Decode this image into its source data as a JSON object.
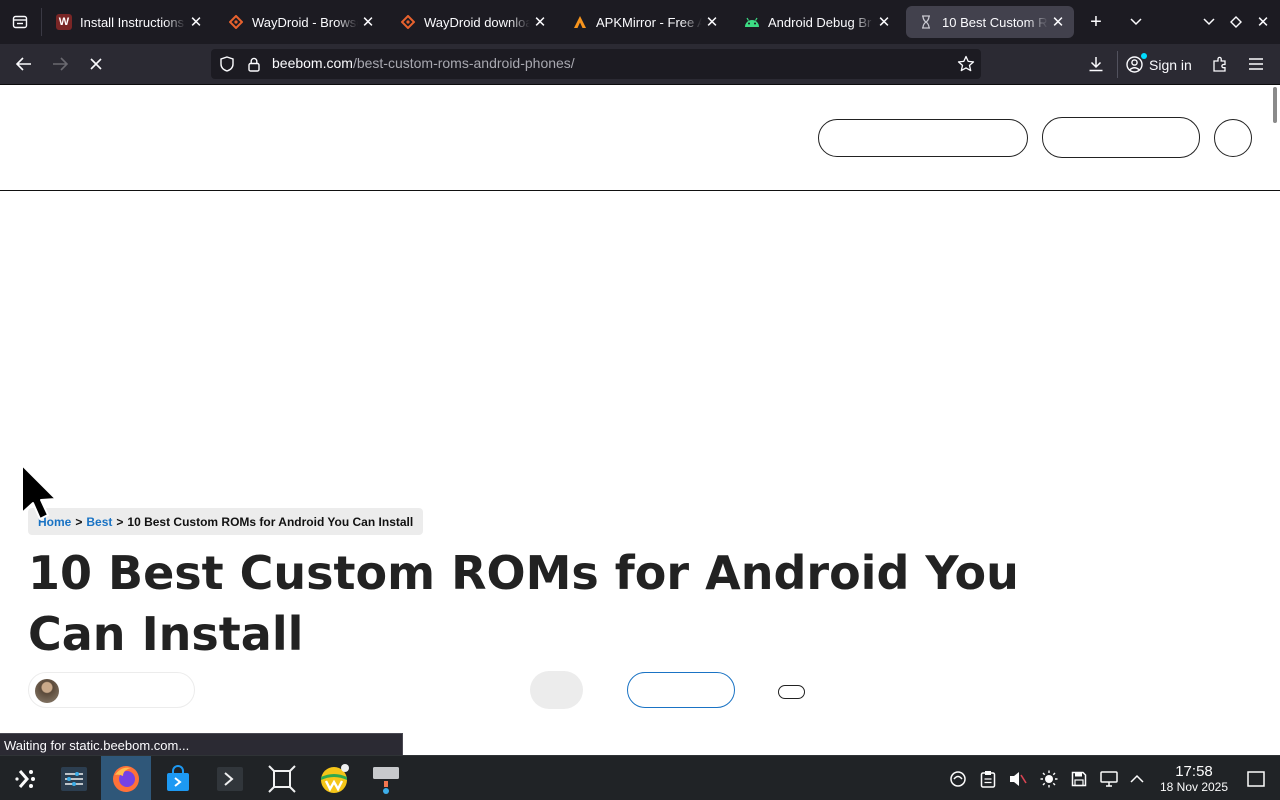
{
  "browser": {
    "tabs": [
      {
        "title": "Install Instructions",
        "favicon": "waydroid-w-icon",
        "active": false
      },
      {
        "title": "WayDroid - Browse",
        "favicon": "sourcehut-diamond-icon",
        "active": false
      },
      {
        "title": "WayDroid download",
        "favicon": "sourcehut-diamond-icon",
        "active": false
      },
      {
        "title": "APKMirror - Free A",
        "favicon": "apkmirror-a-icon",
        "active": false
      },
      {
        "title": "Android Debug Br",
        "favicon": "android-robot-icon",
        "active": false
      },
      {
        "title": "10 Best Custom R",
        "favicon": "loading-hourglass-icon",
        "active": true
      }
    ],
    "url": {
      "host": "beebom.com",
      "path": "/best-custom-roms-android-phones/"
    },
    "sign_in_label": "Sign in",
    "status_text": "Waiting for static.beebom.com...",
    "loading": true
  },
  "page": {
    "breadcrumb": {
      "home": "Home",
      "separator": ">",
      "category": "Best",
      "current": "10 Best Custom ROMs for Android You Can Install"
    },
    "headline": "10 Best Custom ROMs for Android You Can Install"
  },
  "taskbar": {
    "apps": [
      "app-launcher-icon",
      "system-settings-icon",
      "firefox-icon",
      "discover-store-icon",
      "terminal-icon",
      "screenshot-tool-icon",
      "waydroid-icon",
      "input-method-icon"
    ],
    "active_app": "firefox-icon",
    "tray": [
      "kde-connect-icon",
      "clipboard-icon",
      "volume-muted-icon",
      "brightness-icon",
      "disk-icon",
      "display-icon",
      "expand-tray-icon"
    ],
    "time": "17:58",
    "date": "18 Nov 2025"
  },
  "colors": {
    "chrome_dark": "#1c1b22",
    "toolbar": "#2b2a33",
    "link": "#1a73c4",
    "taskbar": "#202326",
    "taskbar_active": "#2f5779"
  }
}
